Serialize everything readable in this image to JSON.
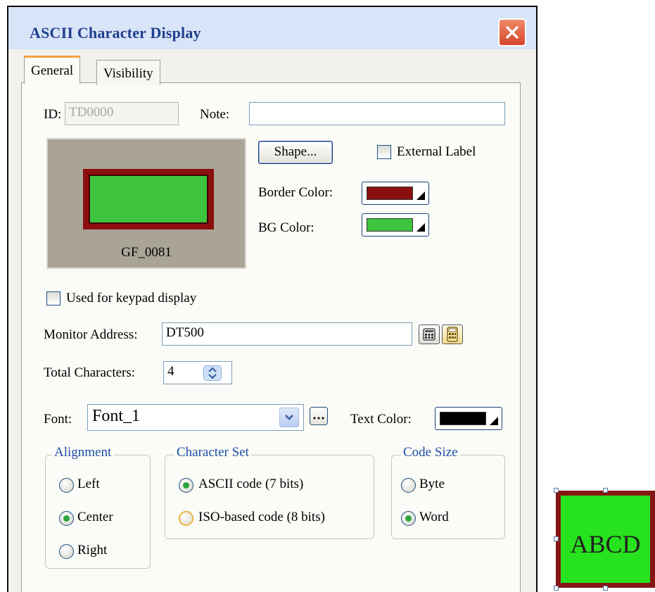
{
  "dialog": {
    "title": "ASCII Character Display",
    "tabs": [
      {
        "label": "General",
        "active": true
      },
      {
        "label": "Visibility",
        "active": false
      }
    ]
  },
  "general": {
    "id_label": "ID:",
    "id_value": "TD0000",
    "note_label": "Note:",
    "note_value": "",
    "preview_caption": "GF_0081",
    "shape_button": "Shape...",
    "external_label": {
      "label": "External Label",
      "checked": false
    },
    "border_color": {
      "label": "Border Color:",
      "color": "#8b0f0f"
    },
    "bg_color": {
      "label": "BG Color:",
      "color": "#3ec43e"
    },
    "keypad_display": {
      "label": "Used for keypad display",
      "checked": false
    },
    "monitor_address": {
      "label": "Monitor Address:",
      "value": "DT500"
    },
    "total_characters": {
      "label": "Total Characters:",
      "value": "4"
    },
    "font": {
      "label": "Font:",
      "value": "Font_1"
    },
    "text_color": {
      "label": "Text Color:",
      "color": "#000000"
    },
    "alignment": {
      "title": "Alignment",
      "options": [
        {
          "label": "Left",
          "selected": false
        },
        {
          "label": "Center",
          "selected": true
        },
        {
          "label": "Right",
          "selected": false
        }
      ]
    },
    "character_set": {
      "title": "Character Set",
      "options": [
        {
          "label": "ASCII code (7 bits)",
          "selected": true
        },
        {
          "label": "ISO-based code (8 bits)",
          "selected": false
        }
      ]
    },
    "code_size": {
      "title": "Code Size",
      "options": [
        {
          "label": "Byte",
          "selected": false
        },
        {
          "label": "Word",
          "selected": true
        }
      ]
    }
  },
  "side_widget": {
    "text": "ABCD",
    "bg_color": "#27e21e",
    "border_color": "#861616"
  },
  "icons": [
    "close-icon",
    "calculator-icon",
    "keypad-icon",
    "chevron-down-icon",
    "spinner-icon",
    "ellipsis-icon"
  ]
}
